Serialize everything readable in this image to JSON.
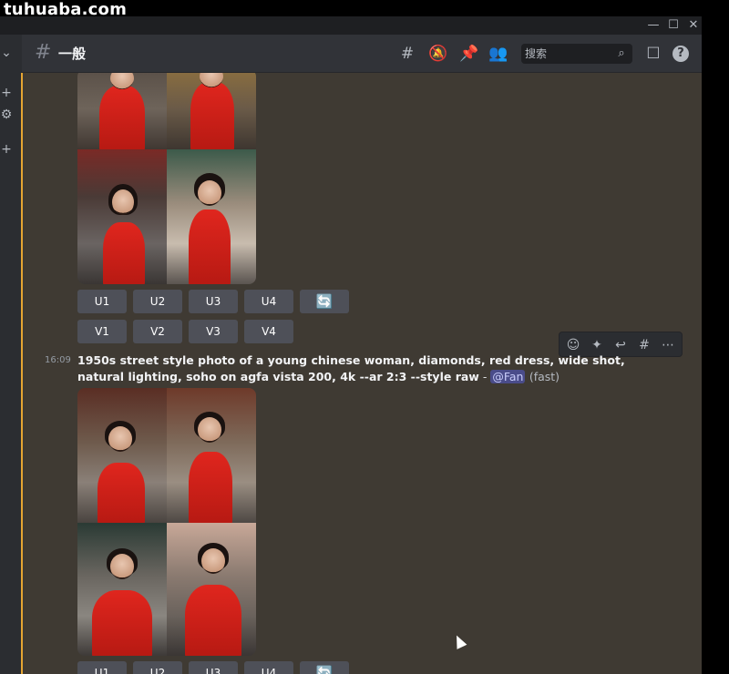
{
  "watermark": "tuhuaba.com",
  "window": {
    "minimize_glyph": "—",
    "maximize_glyph": "☐",
    "close_glyph": "✕"
  },
  "leftstrip": {
    "chevron_glyph": "⌄",
    "add_glyph": "+",
    "gear_glyph": "⚙",
    "add2_glyph": "+"
  },
  "header": {
    "hash_glyph": "#",
    "channel_name": "一般",
    "icons": {
      "threads": "#",
      "mute": "🔕",
      "pin": "📌",
      "members": "👥",
      "inbox": "☐",
      "help": "?"
    },
    "search_placeholder": "搜索",
    "search_icon": "⌕"
  },
  "upscale_buttons": [
    "U1",
    "U2",
    "U3",
    "U4"
  ],
  "variation_buttons": [
    "V1",
    "V2",
    "V3",
    "V4"
  ],
  "reroll_glyph": "🔄",
  "message": {
    "timestamp": "16:09",
    "prompt_bold": "1950s street style photo of a young chinese woman, diamonds, red dress, wide shot, natural lighting, soho on agfa vista 200, 4k --ar 2:3 --style raw",
    "separator": " - ",
    "mention": "@Fan",
    "speed": "(fast)"
  },
  "hover_toolbar": {
    "add_reaction": "☺",
    "super_reaction": "✦",
    "reply": "↩",
    "create_thread": "#",
    "more": "⋯"
  },
  "colors": {
    "chat_bg": "#3f3a33",
    "accent": "#e6a532",
    "button_bg": "#4e5058",
    "dress_red": "#e0261e"
  }
}
